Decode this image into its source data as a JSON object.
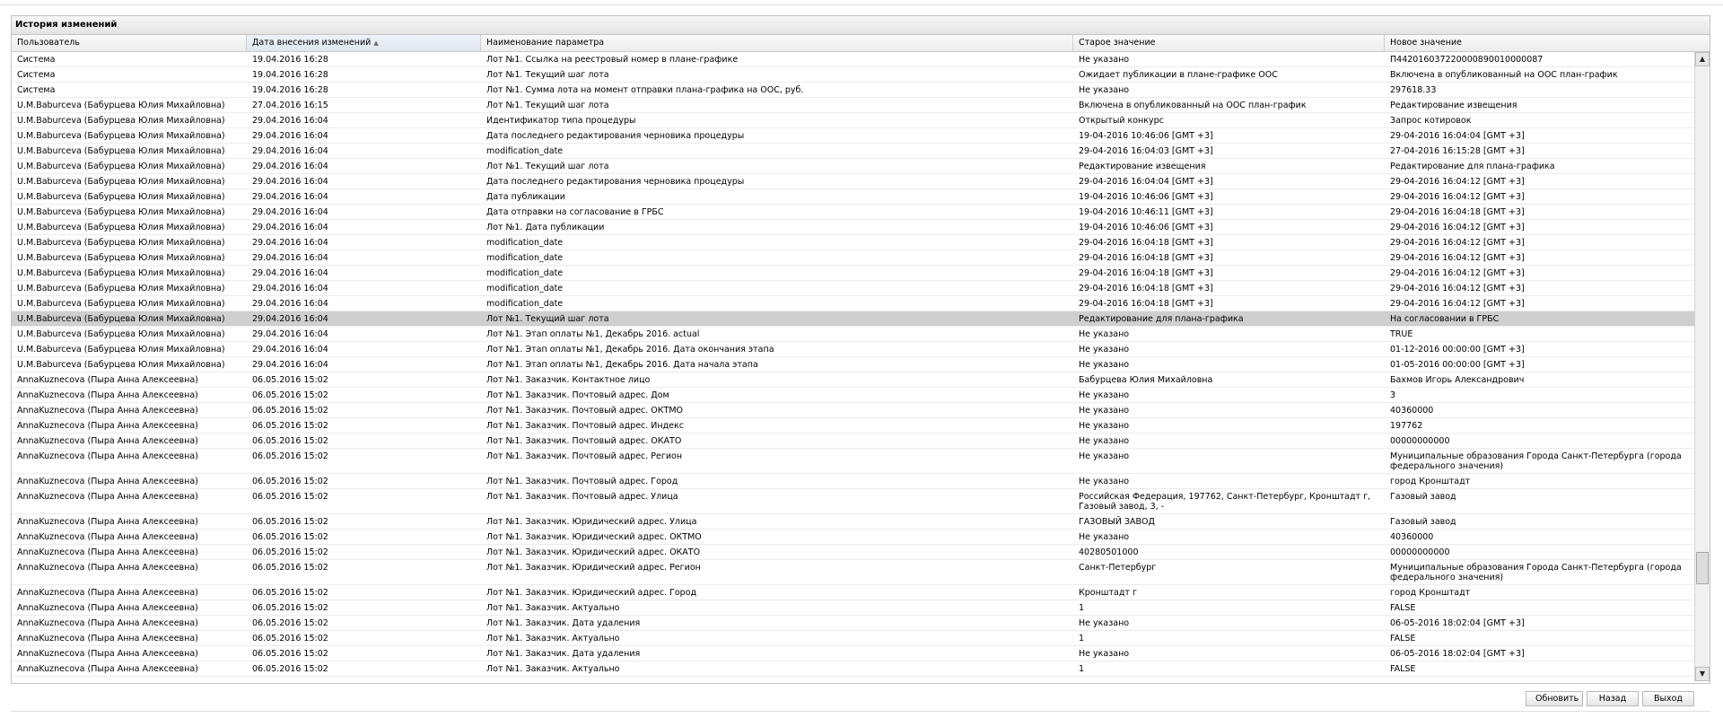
{
  "panel": {
    "title": "История изменений"
  },
  "columns": [
    {
      "label": "Пользователь"
    },
    {
      "label": "Дата внесения изменений"
    },
    {
      "label": "Наименование параметра"
    },
    {
      "label": "Старое значение"
    },
    {
      "label": "Новое значение"
    }
  ],
  "sort": {
    "column": 1,
    "direction": "asc"
  },
  "rows": [
    [
      "Система",
      "19.04.2016 16:28",
      "Лот №1. Ссылка на реестровый номер в плане-графике",
      "Не указано",
      "П442016037220000890010000087"
    ],
    [
      "Система",
      "19.04.2016 16:28",
      "Лот №1. Текущий шаг лота",
      "Ожидает публикации в плане-графике ООС",
      "Включена в опубликованный на ООС план-график"
    ],
    [
      "Система",
      "19.04.2016 16:28",
      "Лот №1. Сумма лота на момент отправки плана-графика на ООС, руб.",
      "Не указано",
      "297618.33"
    ],
    [
      "U.M.Baburceva (Бабурцева Юлия Михайловна)",
      "27.04.2016 16:15",
      "Лот №1. Текущий шаг лота",
      "Включена в опубликованный на ООС план-график",
      "Редактирование извещения"
    ],
    [
      "U.M.Baburceva (Бабурцева Юлия Михайловна)",
      "29.04.2016 16:04",
      "Идентификатор типа процедуры",
      "Открытый конкурс",
      "Запрос котировок"
    ],
    [
      "U.M.Baburceva (Бабурцева Юлия Михайловна)",
      "29.04.2016 16:04",
      "Дата последнего редактирования черновика процедуры",
      "19-04-2016 10:46:06 [GMT +3]",
      "29-04-2016 16:04:04 [GMT +3]"
    ],
    [
      "U.M.Baburceva (Бабурцева Юлия Михайловна)",
      "29.04.2016 16:04",
      "modification_date",
      "29-04-2016 16:04:03 [GMT +3]",
      "27-04-2016 16:15:28 [GMT +3]"
    ],
    [
      "U.M.Baburceva (Бабурцева Юлия Михайловна)",
      "29.04.2016 16:04",
      "Лот №1. Текущий шаг лота",
      "Редактирование извещения",
      "Редактирование для плана-графика"
    ],
    [
      "U.M.Baburceva (Бабурцева Юлия Михайловна)",
      "29.04.2016 16:04",
      "Дата последнего редактирования черновика процедуры",
      "29-04-2016 16:04:04 [GMT +3]",
      "29-04-2016 16:04:12 [GMT +3]"
    ],
    [
      "U.M.Baburceva (Бабурцева Юлия Михайловна)",
      "29.04.2016 16:04",
      "Дата публикации",
      "19-04-2016 10:46:06 [GMT +3]",
      "29-04-2016 16:04:12 [GMT +3]"
    ],
    [
      "U.M.Baburceva (Бабурцева Юлия Михайловна)",
      "29.04.2016 16:04",
      "Дата отправки на согласование в ГРБС",
      "19-04-2016 10:46:11 [GMT +3]",
      "29-04-2016 16:04:18 [GMT +3]"
    ],
    [
      "U.M.Baburceva (Бабурцева Юлия Михайловна)",
      "29.04.2016 16:04",
      "Лот №1. Дата публикации",
      "19-04-2016 10:46:06 [GMT +3]",
      "29-04-2016 16:04:12 [GMT +3]"
    ],
    [
      "U.M.Baburceva (Бабурцева Юлия Михайловна)",
      "29.04.2016 16:04",
      "modification_date",
      "29-04-2016 16:04:18 [GMT +3]",
      "29-04-2016 16:04:12 [GMT +3]"
    ],
    [
      "U.M.Baburceva (Бабурцева Юлия Михайловна)",
      "29.04.2016 16:04",
      "modification_date",
      "29-04-2016 16:04:18 [GMT +3]",
      "29-04-2016 16:04:12 [GMT +3]"
    ],
    [
      "U.M.Baburceva (Бабурцева Юлия Михайловна)",
      "29.04.2016 16:04",
      "modification_date",
      "29-04-2016 16:04:18 [GMT +3]",
      "29-04-2016 16:04:12 [GMT +3]"
    ],
    [
      "U.M.Baburceva (Бабурцева Юлия Михайловна)",
      "29.04.2016 16:04",
      "modification_date",
      "29-04-2016 16:04:18 [GMT +3]",
      "29-04-2016 16:04:12 [GMT +3]"
    ],
    [
      "U.M.Baburceva (Бабурцева Юлия Михайловна)",
      "29.04.2016 16:04",
      "modification_date",
      "29-04-2016 16:04:18 [GMT +3]",
      "29-04-2016 16:04:12 [GMT +3]"
    ],
    [
      "U.M.Baburceva (Бабурцева Юлия Михайловна)",
      "29.04.2016 16:04",
      "Лот №1. Текущий шаг лота",
      "Редактирование для плана-графика",
      "На согласовании в ГРБС"
    ],
    [
      "U.M.Baburceva (Бабурцева Юлия Михайловна)",
      "29.04.2016 16:04",
      "Лот №1. Этап оплаты №1, Декабрь 2016. actual",
      "Не указано",
      "TRUE"
    ],
    [
      "U.M.Baburceva (Бабурцева Юлия Михайловна)",
      "29.04.2016 16:04",
      "Лот №1. Этап оплаты №1, Декабрь 2016. Дата окончания этапа",
      "Не указано",
      "01-12-2016 00:00:00 [GMT +3]"
    ],
    [
      "U.M.Baburceva (Бабурцева Юлия Михайловна)",
      "29.04.2016 16:04",
      "Лот №1. Этап оплаты №1, Декабрь 2016. Дата начала этапа",
      "Не указано",
      "01-05-2016 00:00:00 [GMT +3]"
    ],
    [
      "AnnaKuznecova (Пыра Анна Алексеевна)",
      "06.05.2016 15:02",
      "Лот №1. Заказчик. Контактное лицо",
      "Бабурцева Юлия Михайловна",
      "Бахмов Игорь Александрович"
    ],
    [
      "AnnaKuznecova (Пыра Анна Алексеевна)",
      "06.05.2016 15:02",
      "Лот №1. Заказчик. Почтовый адрес. Дом",
      "Не указано",
      "3"
    ],
    [
      "AnnaKuznecova (Пыра Анна Алексеевна)",
      "06.05.2016 15:02",
      "Лот №1. Заказчик. Почтовый адрес. ОКТМО",
      "Не указано",
      "40360000"
    ],
    [
      "AnnaKuznecova (Пыра Анна Алексеевна)",
      "06.05.2016 15:02",
      "Лот №1. Заказчик. Почтовый адрес. Индекс",
      "Не указано",
      "197762"
    ],
    [
      "AnnaKuznecova (Пыра Анна Алексеевна)",
      "06.05.2016 15:02",
      "Лот №1. Заказчик. Почтовый адрес. ОКАТО",
      "Не указано",
      "00000000000"
    ],
    [
      "AnnaKuznecova (Пыра Анна Алексеевна)",
      "06.05.2016 15:02",
      "Лот №1. Заказчик. Почтовый адрес. Регион",
      "Не указано",
      "Муниципальные образования Города Санкт-Петербурга (города федерального значения)"
    ],
    [
      "AnnaKuznecova (Пыра Анна Алексеевна)",
      "06.05.2016 15:02",
      "Лот №1. Заказчик. Почтовый адрес. Город",
      "Не указано",
      "город Кронштадт"
    ],
    [
      "AnnaKuznecova (Пыра Анна Алексеевна)",
      "06.05.2016 15:02",
      "Лот №1. Заказчик. Почтовый адрес. Улица",
      "Российская Федерация, 197762, Санкт-Петербург, Кронштадт г, Газовый завод, 3, -",
      "Газовый завод"
    ],
    [
      "AnnaKuznecova (Пыра Анна Алексеевна)",
      "06.05.2016 15:02",
      "Лот №1. Заказчик. Юридический адрес. Улица",
      "ГАЗОВЫЙ ЗАВОД",
      "Газовый завод"
    ],
    [
      "AnnaKuznecova (Пыра Анна Алексеевна)",
      "06.05.2016 15:02",
      "Лот №1. Заказчик. Юридический адрес. ОКТМО",
      "Не указано",
      "40360000"
    ],
    [
      "AnnaKuznecova (Пыра Анна Алексеевна)",
      "06.05.2016 15:02",
      "Лот №1. Заказчик. Юридический адрес. ОКАТО",
      "40280501000",
      "00000000000"
    ],
    [
      "AnnaKuznecova (Пыра Анна Алексеевна)",
      "06.05.2016 15:02",
      "Лот №1. Заказчик. Юридический адрес. Регион",
      "Санкт-Петербург",
      "Муниципальные образования Города Санкт-Петербурга (города федерального значения)"
    ],
    [
      "AnnaKuznecova (Пыра Анна Алексеевна)",
      "06.05.2016 15:02",
      "Лот №1. Заказчик. Юридический адрес. Город",
      "Кронштадт г",
      "город Кронштадт"
    ],
    [
      "AnnaKuznecova (Пыра Анна Алексеевна)",
      "06.05.2016 15:02",
      "Лот №1. Заказчик. Актуально",
      "1",
      "FALSE"
    ],
    [
      "AnnaKuznecova (Пыра Анна Алексеевна)",
      "06.05.2016 15:02",
      "Лот №1. Заказчик. Дата удаления",
      "Не указано",
      "06-05-2016 18:02:04 [GMT +3]"
    ],
    [
      "AnnaKuznecova (Пыра Анна Алексеевна)",
      "06.05.2016 15:02",
      "Лот №1. Заказчик. Актуально",
      "1",
      "FALSE"
    ],
    [
      "AnnaKuznecova (Пыра Анна Алексеевна)",
      "06.05.2016 15:02",
      "Лот №1. Заказчик. Дата удаления",
      "Не указано",
      "06-05-2016 18:02:04 [GMT +3]"
    ],
    [
      "AnnaKuznecova (Пыра Анна Алексеевна)",
      "06.05.2016 15:02",
      "Лот №1. Заказчик. Актуально",
      "1",
      "FALSE"
    ]
  ],
  "selected_row": 17,
  "scrollbar": {
    "up_icon": "▲",
    "down_icon": "▼"
  },
  "buttons": {
    "refresh": "Обновить",
    "back": "Назад",
    "exit": "Выход"
  }
}
